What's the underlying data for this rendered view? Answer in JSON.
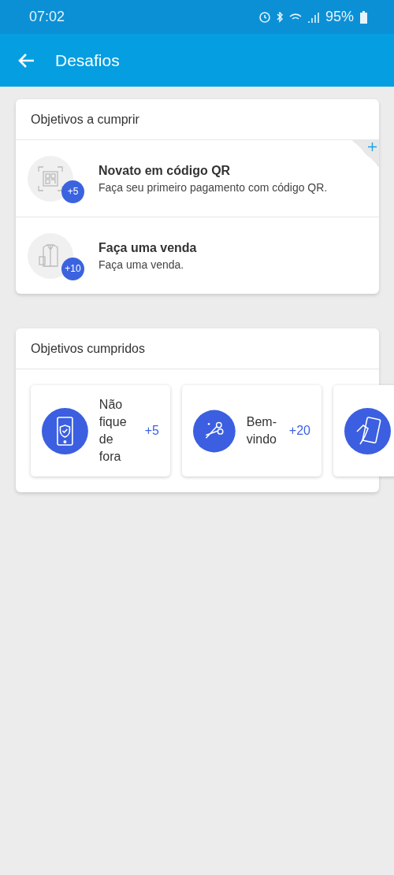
{
  "status_bar": {
    "time": "07:02",
    "battery": "95%"
  },
  "app_bar": {
    "title": "Desafios"
  },
  "pending": {
    "title": "Objetivos a cumprir",
    "items": [
      {
        "title": "Novato em código QR",
        "description": "Faça seu primeiro pagamento com código QR.",
        "points": "+5",
        "new": true
      },
      {
        "title": "Faça uma venda",
        "description": "Faça uma venda.",
        "points": "+10",
        "new": false
      }
    ]
  },
  "completed": {
    "title": "Objetivos cumpridos",
    "items": [
      {
        "kind": "full",
        "title": "Não fique de fora",
        "points": "+5"
      },
      {
        "kind": "full",
        "title": "Bem-vindo",
        "points": "+20"
      },
      {
        "kind": "icon_only"
      }
    ]
  }
}
